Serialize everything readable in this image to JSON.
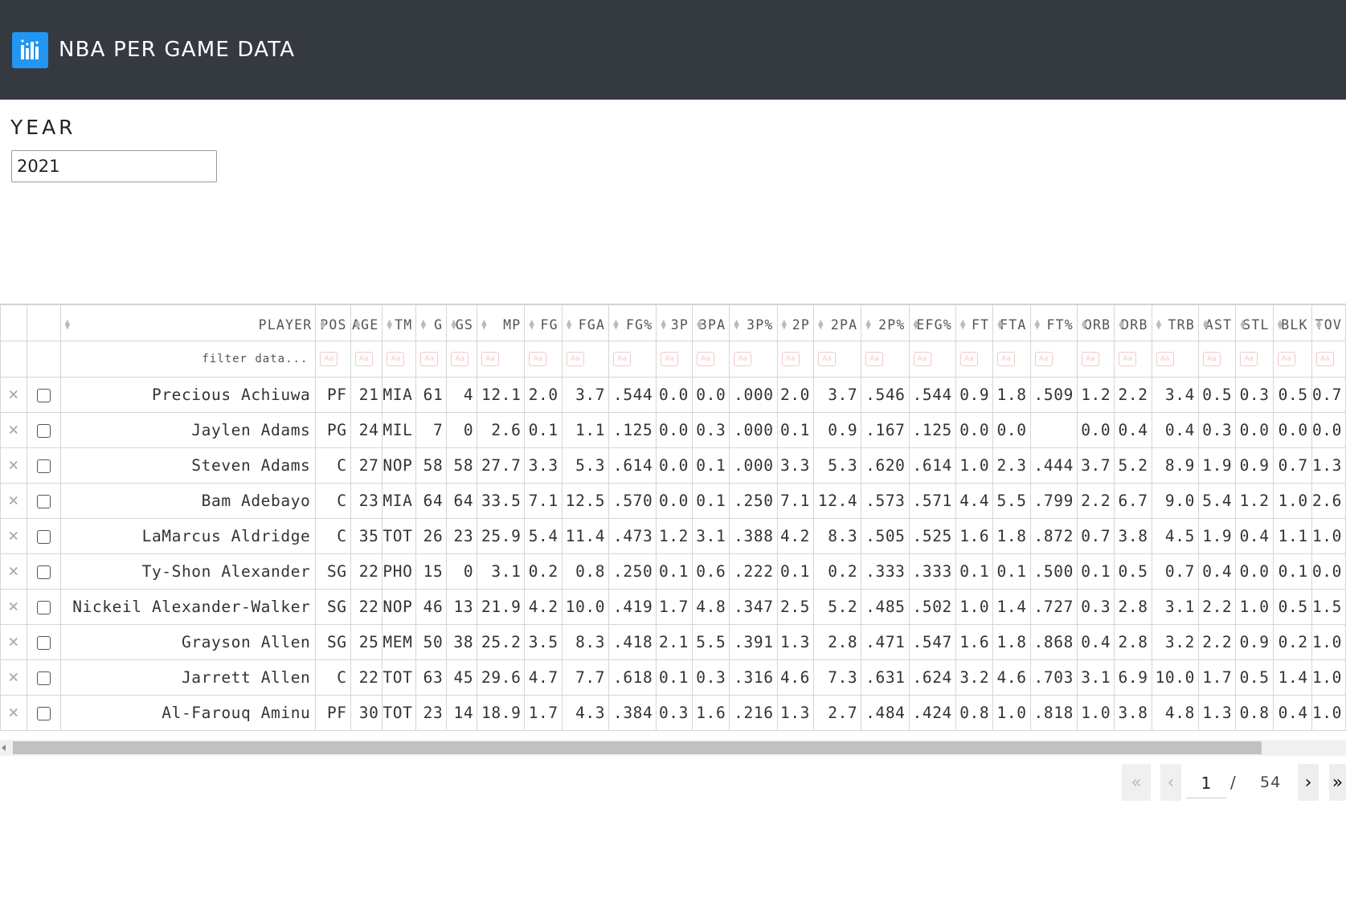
{
  "app": {
    "title": "NBA PER GAME DATA",
    "logo": "bar-chart-logo"
  },
  "year_filter": {
    "label": "YEAR",
    "value": "2021"
  },
  "table": {
    "filter_placeholder": "filter data...",
    "columns": [
      {
        "key": "player",
        "label": "PLAYER"
      },
      {
        "key": "pos",
        "label": "POS"
      },
      {
        "key": "age",
        "label": "AGE"
      },
      {
        "key": "tm",
        "label": "TM"
      },
      {
        "key": "g",
        "label": "G"
      },
      {
        "key": "gs",
        "label": "GS"
      },
      {
        "key": "mp",
        "label": "MP"
      },
      {
        "key": "fg",
        "label": "FG"
      },
      {
        "key": "fga",
        "label": "FGA"
      },
      {
        "key": "fgp",
        "label": "FG%"
      },
      {
        "key": "3p",
        "label": "3P"
      },
      {
        "key": "3pa",
        "label": "3PA"
      },
      {
        "key": "3pp",
        "label": "3P%"
      },
      {
        "key": "2p",
        "label": "2P"
      },
      {
        "key": "2pa",
        "label": "2PA"
      },
      {
        "key": "2pp",
        "label": "2P%"
      },
      {
        "key": "efg",
        "label": "EFG%"
      },
      {
        "key": "ft",
        "label": "FT"
      },
      {
        "key": "fta",
        "label": "FTA"
      },
      {
        "key": "ftp",
        "label": "FT%"
      },
      {
        "key": "orb",
        "label": "ORB"
      },
      {
        "key": "drb",
        "label": "DRB"
      },
      {
        "key": "trb",
        "label": "TRB"
      },
      {
        "key": "ast",
        "label": "AST"
      },
      {
        "key": "stl",
        "label": "STL"
      },
      {
        "key": "blk",
        "label": "BLK"
      },
      {
        "key": "tov",
        "label": "TOV"
      }
    ],
    "rows": [
      [
        "Precious Achiuwa",
        "PF",
        "21",
        "MIA",
        "61",
        "4",
        "12.1",
        "2.0",
        "3.7",
        ".544",
        "0.0",
        "0.0",
        ".000",
        "2.0",
        "3.7",
        ".546",
        ".544",
        "0.9",
        "1.8",
        ".509",
        "1.2",
        "2.2",
        "3.4",
        "0.5",
        "0.3",
        "0.5",
        "0.7"
      ],
      [
        "Jaylen Adams",
        "PG",
        "24",
        "MIL",
        "7",
        "0",
        "2.6",
        "0.1",
        "1.1",
        ".125",
        "0.0",
        "0.3",
        ".000",
        "0.1",
        "0.9",
        ".167",
        ".125",
        "0.0",
        "0.0",
        "",
        "0.0",
        "0.4",
        "0.4",
        "0.3",
        "0.0",
        "0.0",
        "0.0"
      ],
      [
        "Steven Adams",
        "C",
        "27",
        "NOP",
        "58",
        "58",
        "27.7",
        "3.3",
        "5.3",
        ".614",
        "0.0",
        "0.1",
        ".000",
        "3.3",
        "5.3",
        ".620",
        ".614",
        "1.0",
        "2.3",
        ".444",
        "3.7",
        "5.2",
        "8.9",
        "1.9",
        "0.9",
        "0.7",
        "1.3"
      ],
      [
        "Bam Adebayo",
        "C",
        "23",
        "MIA",
        "64",
        "64",
        "33.5",
        "7.1",
        "12.5",
        ".570",
        "0.0",
        "0.1",
        ".250",
        "7.1",
        "12.4",
        ".573",
        ".571",
        "4.4",
        "5.5",
        ".799",
        "2.2",
        "6.7",
        "9.0",
        "5.4",
        "1.2",
        "1.0",
        "2.6"
      ],
      [
        "LaMarcus Aldridge",
        "C",
        "35",
        "TOT",
        "26",
        "23",
        "25.9",
        "5.4",
        "11.4",
        ".473",
        "1.2",
        "3.1",
        ".388",
        "4.2",
        "8.3",
        ".505",
        ".525",
        "1.6",
        "1.8",
        ".872",
        "0.7",
        "3.8",
        "4.5",
        "1.9",
        "0.4",
        "1.1",
        "1.0"
      ],
      [
        "Ty-Shon Alexander",
        "SG",
        "22",
        "PHO",
        "15",
        "0",
        "3.1",
        "0.2",
        "0.8",
        ".250",
        "0.1",
        "0.6",
        ".222",
        "0.1",
        "0.2",
        ".333",
        ".333",
        "0.1",
        "0.1",
        ".500",
        "0.1",
        "0.5",
        "0.7",
        "0.4",
        "0.0",
        "0.1",
        "0.0"
      ],
      [
        "Nickeil Alexander-Walker",
        "SG",
        "22",
        "NOP",
        "46",
        "13",
        "21.9",
        "4.2",
        "10.0",
        ".419",
        "1.7",
        "4.8",
        ".347",
        "2.5",
        "5.2",
        ".485",
        ".502",
        "1.0",
        "1.4",
        ".727",
        "0.3",
        "2.8",
        "3.1",
        "2.2",
        "1.0",
        "0.5",
        "1.5"
      ],
      [
        "Grayson Allen",
        "SG",
        "25",
        "MEM",
        "50",
        "38",
        "25.2",
        "3.5",
        "8.3",
        ".418",
        "2.1",
        "5.5",
        ".391",
        "1.3",
        "2.8",
        ".471",
        ".547",
        "1.6",
        "1.8",
        ".868",
        "0.4",
        "2.8",
        "3.2",
        "2.2",
        "0.9",
        "0.2",
        "1.0"
      ],
      [
        "Jarrett Allen",
        "C",
        "22",
        "TOT",
        "63",
        "45",
        "29.6",
        "4.7",
        "7.7",
        ".618",
        "0.1",
        "0.3",
        ".316",
        "4.6",
        "7.3",
        ".631",
        ".624",
        "3.2",
        "4.6",
        ".703",
        "3.1",
        "6.9",
        "10.0",
        "1.7",
        "0.5",
        "1.4",
        "1.0"
      ],
      [
        "Al-Farouq Aminu",
        "PF",
        "30",
        "TOT",
        "23",
        "14",
        "18.9",
        "1.7",
        "4.3",
        ".384",
        "0.3",
        "1.6",
        ".216",
        "1.3",
        "2.7",
        ".484",
        ".424",
        "0.8",
        "1.0",
        ".818",
        "1.0",
        "3.8",
        "4.8",
        "1.3",
        "0.8",
        "0.4",
        "1.0"
      ]
    ]
  },
  "pagination": {
    "current_page": "1",
    "separator": "/",
    "total_pages": "54"
  }
}
